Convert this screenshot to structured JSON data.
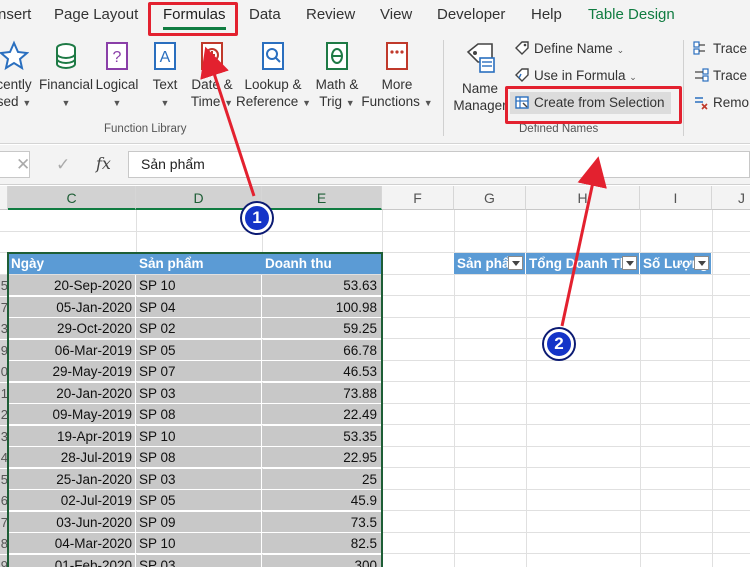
{
  "ribbon_tabs": [
    "nsert",
    "Page Layout",
    "Formulas",
    "Data",
    "Review",
    "View",
    "Developer",
    "Help",
    "Table Design"
  ],
  "active_tab": "Formulas",
  "function_library": {
    "buttons": [
      {
        "line1": "cently",
        "line2": "sed"
      },
      {
        "line1": "Financial",
        "line2": ""
      },
      {
        "line1": "Logical",
        "line2": ""
      },
      {
        "line1": "Text",
        "line2": ""
      },
      {
        "line1": "Date &",
        "line2": "Time"
      },
      {
        "line1": "Lookup &",
        "line2": "Reference"
      },
      {
        "line1": "Math &",
        "line2": "Trig"
      },
      {
        "line1": "More",
        "line2": "Functions"
      }
    ],
    "label": "Function Library"
  },
  "defined_names": {
    "name_manager_line1": "Name",
    "name_manager_line2": "Manager",
    "define_name": "Define Name",
    "use_in_formula": "Use in Formula",
    "create_from_selection": "Create from Selection",
    "label": "Defined Names"
  },
  "formula_auditing": {
    "trace1": "Trace",
    "trace2": "Trace",
    "remove": "Remo"
  },
  "formula_bar": {
    "cancel": "✕",
    "enter": "✓",
    "fx": "fx",
    "value": "Sản phẩm"
  },
  "columns": [
    "C",
    "D",
    "E",
    "F",
    "G",
    "H",
    "I",
    "J"
  ],
  "table": {
    "headers": [
      "Ngày",
      "Sản phẩm",
      "Doanh thu"
    ],
    "row_stubs": [
      "5",
      "7",
      "3",
      "9",
      "0",
      "1",
      "2",
      "3",
      "4",
      "5",
      "6",
      "7",
      "8",
      "9"
    ],
    "rows": [
      [
        "20-Sep-2020",
        "SP 10",
        "53.63"
      ],
      [
        "05-Jan-2020",
        "SP 04",
        "100.98"
      ],
      [
        "29-Oct-2020",
        "SP 02",
        "59.25"
      ],
      [
        "06-Mar-2019",
        "SP 05",
        "66.78"
      ],
      [
        "29-May-2019",
        "SP 07",
        "46.53"
      ],
      [
        "20-Jan-2020",
        "SP 03",
        "73.88"
      ],
      [
        "09-May-2019",
        "SP 08",
        "22.49"
      ],
      [
        "19-Apr-2019",
        "SP 10",
        "53.35"
      ],
      [
        "28-Jul-2019",
        "SP 08",
        "22.95"
      ],
      [
        "25-Jan-2020",
        "SP 03",
        "25"
      ],
      [
        "02-Jul-2019",
        "SP 05",
        "45.9"
      ],
      [
        "03-Jun-2020",
        "SP 09",
        "73.5"
      ],
      [
        "04-Mar-2020",
        "SP 10",
        "82.5"
      ],
      [
        "01-Feb-2020",
        "SP 03",
        "300"
      ]
    ]
  },
  "pivot_headers": [
    "Sản phẩm",
    "Tổng Doanh Thu",
    "Số Lượng"
  ],
  "badges": [
    "1",
    "2"
  ],
  "colors": {
    "accent": "#107c41",
    "table_header": "#5b9bd5",
    "table_body": "#c8c8c8",
    "annotation": "#e3212f",
    "badge": "#1434c8"
  }
}
